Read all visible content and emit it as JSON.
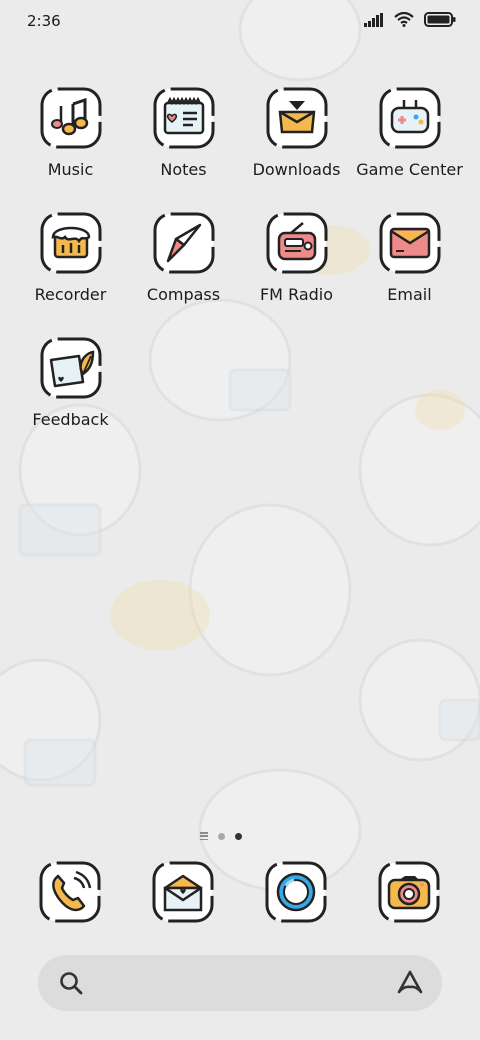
{
  "status_bar": {
    "time": "2:36"
  },
  "apps": [
    {
      "label": "Music",
      "icon": "music-icon"
    },
    {
      "label": "Notes",
      "icon": "notes-icon"
    },
    {
      "label": "Downloads",
      "icon": "downloads-icon"
    },
    {
      "label": "Game Center",
      "icon": "gamepad-icon"
    },
    {
      "label": "Recorder",
      "icon": "recorder-icon"
    },
    {
      "label": "Compass",
      "icon": "compass-icon"
    },
    {
      "label": "FM Radio",
      "icon": "radio-icon"
    },
    {
      "label": "Email",
      "icon": "email-icon"
    },
    {
      "label": "Feedback",
      "icon": "feedback-icon"
    }
  ],
  "dock": [
    {
      "icon": "phone-icon"
    },
    {
      "icon": "messages-icon"
    },
    {
      "icon": "browser-icon"
    },
    {
      "icon": "camera-icon"
    }
  ],
  "page_indicator": {
    "pages": 2,
    "active": 2
  },
  "colors": {
    "background": "#ebebeb",
    "accent_yellow": "#f5b84c",
    "accent_pink": "#ef8a8a",
    "accent_blue": "#39a8e8",
    "outline": "#222222"
  }
}
